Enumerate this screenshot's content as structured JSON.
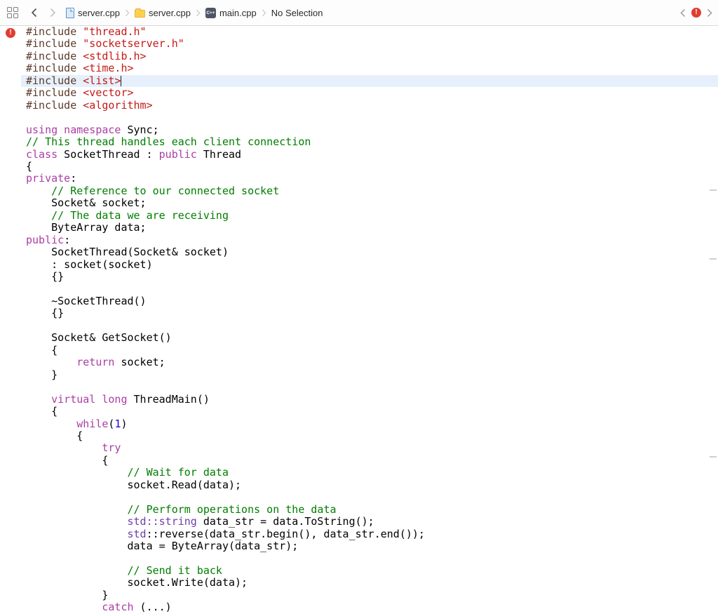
{
  "jumpbar": {
    "items": [
      {
        "label": "server.cpp"
      },
      {
        "label": "server.cpp"
      },
      {
        "label": "main.cpp"
      },
      {
        "label": "No Selection"
      }
    ],
    "cpp_icon_text": "C++",
    "issue_badge": "!"
  },
  "gutter": {
    "issue_badge": "!"
  },
  "editor": {
    "active_line": 4,
    "colors": {
      "pre": "#5b3a29",
      "str": "#c41a16",
      "kw": "#ad3da4",
      "com": "#007e00",
      "pln": "#000000",
      "typ": "#703daa",
      "num": "#1c00cf"
    },
    "lines": [
      [
        [
          "pre",
          "#include "
        ],
        [
          "str",
          "\"thread.h\""
        ]
      ],
      [
        [
          "pre",
          "#include "
        ],
        [
          "str",
          "\"socketserver.h\""
        ]
      ],
      [
        [
          "pre",
          "#include "
        ],
        [
          "str",
          "<stdlib.h>"
        ]
      ],
      [
        [
          "pre",
          "#include "
        ],
        [
          "str",
          "<time.h>"
        ]
      ],
      [
        [
          "pre",
          "#include "
        ],
        [
          "str",
          "<list>"
        ]
      ],
      [
        [
          "pre",
          "#include "
        ],
        [
          "str",
          "<vector>"
        ]
      ],
      [
        [
          "pre",
          "#include "
        ],
        [
          "str",
          "<algorithm>"
        ]
      ],
      [],
      [
        [
          "kw",
          "using namespace"
        ],
        [
          "pln",
          " Sync;"
        ]
      ],
      [
        [
          "com",
          "// This thread handles each client connection"
        ]
      ],
      [
        [
          "kw",
          "class"
        ],
        [
          "pln",
          " SocketThread : "
        ],
        [
          "kw",
          "public"
        ],
        [
          "pln",
          " Thread"
        ]
      ],
      [
        [
          "pln",
          "{"
        ]
      ],
      [
        [
          "kw",
          "private"
        ],
        [
          "pln",
          ":"
        ]
      ],
      [
        [
          "pln",
          "    "
        ],
        [
          "com",
          "// Reference to our connected socket"
        ]
      ],
      [
        [
          "pln",
          "    Socket& socket;"
        ]
      ],
      [
        [
          "pln",
          "    "
        ],
        [
          "com",
          "// The data we are receiving"
        ]
      ],
      [
        [
          "pln",
          "    ByteArray data;"
        ]
      ],
      [
        [
          "kw",
          "public"
        ],
        [
          "pln",
          ":"
        ]
      ],
      [
        [
          "pln",
          "    SocketThread(Socket& socket)"
        ]
      ],
      [
        [
          "pln",
          "    : socket(socket)"
        ]
      ],
      [
        [
          "pln",
          "    {}"
        ]
      ],
      [],
      [
        [
          "pln",
          "    ~SocketThread()"
        ]
      ],
      [
        [
          "pln",
          "    {}"
        ]
      ],
      [],
      [
        [
          "pln",
          "    Socket& GetSocket()"
        ]
      ],
      [
        [
          "pln",
          "    {"
        ]
      ],
      [
        [
          "pln",
          "        "
        ],
        [
          "kw",
          "return"
        ],
        [
          "pln",
          " socket;"
        ]
      ],
      [
        [
          "pln",
          "    }"
        ]
      ],
      [],
      [
        [
          "pln",
          "    "
        ],
        [
          "kw",
          "virtual long"
        ],
        [
          "pln",
          " ThreadMain()"
        ]
      ],
      [
        [
          "pln",
          "    {"
        ]
      ],
      [
        [
          "pln",
          "        "
        ],
        [
          "kw",
          "while"
        ],
        [
          "pln",
          "("
        ],
        [
          "num",
          "1"
        ],
        [
          "pln",
          ")"
        ]
      ],
      [
        [
          "pln",
          "        {"
        ]
      ],
      [
        [
          "pln",
          "            "
        ],
        [
          "kw",
          "try"
        ]
      ],
      [
        [
          "pln",
          "            {"
        ]
      ],
      [
        [
          "pln",
          "                "
        ],
        [
          "com",
          "// Wait for data"
        ]
      ],
      [
        [
          "pln",
          "                socket.Read(data);"
        ]
      ],
      [],
      [
        [
          "pln",
          "                "
        ],
        [
          "com",
          "// Perform operations on the data"
        ]
      ],
      [
        [
          "pln",
          "                "
        ],
        [
          "typ",
          "std::string"
        ],
        [
          "pln",
          " data_str = data.ToString();"
        ]
      ],
      [
        [
          "pln",
          "                "
        ],
        [
          "typ",
          "std"
        ],
        [
          "pln",
          "::reverse(data_str.begin(), data_str.end());"
        ]
      ],
      [
        [
          "pln",
          "                data = ByteArray(data_str);"
        ]
      ],
      [],
      [
        [
          "pln",
          "                "
        ],
        [
          "com",
          "// Send it back"
        ]
      ],
      [
        [
          "pln",
          "                socket.Write(data);"
        ]
      ],
      [
        [
          "pln",
          "            }"
        ]
      ],
      [
        [
          "pln",
          "            "
        ],
        [
          "kw",
          "catch"
        ],
        [
          "pln",
          " (...)"
        ]
      ]
    ]
  }
}
